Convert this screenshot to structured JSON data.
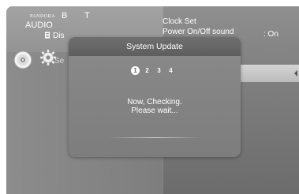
{
  "background_menu": {
    "brand_logo_text": "PANDORA",
    "left_labels": {
      "b": "B",
      "t": "T",
      "audio": "AUDIO",
      "di": "Dis",
      "s": "Se"
    },
    "icons": {
      "small": "document-icon",
      "disc": "disc-icon",
      "settings": "gear-icon"
    },
    "right_items": {
      "clock_set": "Clock Set",
      "power_on_off_sound": "Power On/Off sound",
      "power_value": ": On"
    }
  },
  "dialog": {
    "title": "System Update",
    "steps": [
      "1",
      "2",
      "3",
      "4"
    ],
    "active_step": 1,
    "message_line1": "Now, Checking.",
    "message_line2": "Please wait..."
  },
  "colors": {
    "panel_gray": "#7e7e7e",
    "highlight_row": "#cfcfcf",
    "text": "#ffffff"
  }
}
